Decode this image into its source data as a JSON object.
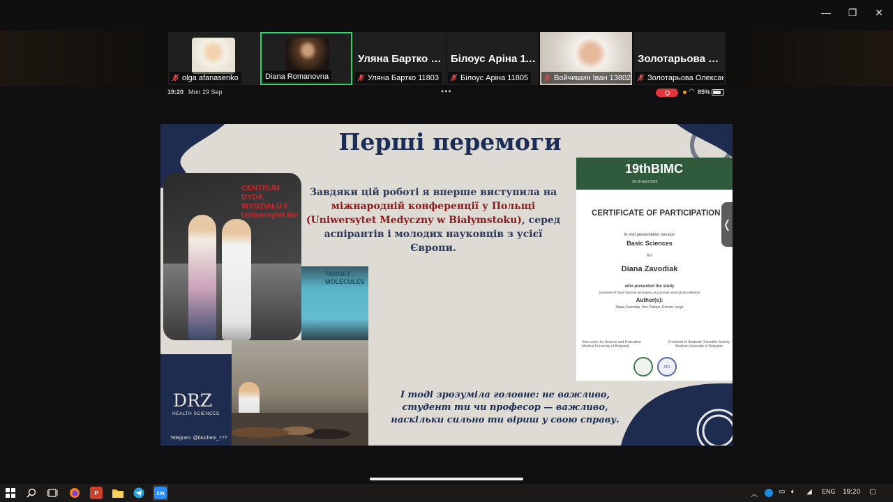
{
  "window": {
    "controls": {
      "minimize": "—",
      "maximize": "❐",
      "close": "✕"
    }
  },
  "gallery": [
    {
      "big_name": "",
      "tag": "olga afanasenko",
      "has_photo": true,
      "active": false,
      "muted": true
    },
    {
      "big_name": "",
      "tag": "Diana Romanovna",
      "has_photo": true,
      "active": true,
      "muted": false
    },
    {
      "big_name": "Уляна Бартко 1...",
      "tag": "Уляна Бартко 11803",
      "has_photo": false,
      "active": false,
      "muted": true
    },
    {
      "big_name": "Білоус Аріна 11...",
      "tag": "Білоус Аріна 11805",
      "has_photo": false,
      "active": false,
      "muted": true
    },
    {
      "big_name": "",
      "tag": "Войчишин Іван 13802...",
      "has_photo": true,
      "active": false,
      "muted": true
    },
    {
      "big_name": "Золотарьова О...",
      "tag": "Золотарьова Олексан...",
      "has_photo": false,
      "active": false,
      "muted": true
    }
  ],
  "ipad_status": {
    "time": "19:20",
    "date": "Mon 29 Sep",
    "dots": "•••",
    "battery": "85%"
  },
  "slide": {
    "title": "Перші перемоги",
    "paragraph_before": "Завдяки цій роботі я вперше виступила на ",
    "paragraph_highlight": "міжнародній конференції у Польщі (Uniwersytet Medyczny w Białymstoku)",
    "paragraph_after": ", серед аспірантів і молодих науковців з усієї Європи.",
    "quote": "І тоді зрозуміла головне: не важливо, студент ти чи професор — важливо, наскільки сильно ти віриш у свою справу.",
    "photo1_banner_lines": [
      "CENTRUM DYDA",
      "WYDZIAŁU F",
      "Uniwersytet Me"
    ],
    "photo2_screen_text": [
      "TARGET",
      "MOLECULES"
    ],
    "logo": {
      "main": "DRZ",
      "sub": "HEALTH SCIENCES",
      "telegram": "Telegram: @biochem_777"
    },
    "certificate": {
      "header": "19thBIMC",
      "dates": "25-26 April 2025",
      "title": "CERTIFICATE OF PARTICIPATION",
      "session_label": "in oral presentation session",
      "session": "Basic Sciences",
      "for": "for",
      "name": "Diana Zavodiak",
      "presented": "who presented the study",
      "study": "Synthesis of fused thiazole derivatives as potential endocytosis inhibitors",
      "authors_label": "Author(s):",
      "authors": "Diana Zavodiak, Ihor Yushyn, Roman Lesyk",
      "sig_left": "Vice-rector for Science and Evaluation\nMedical University of Bialystok",
      "sig_right": "President of Students' Scientific Society\nMedical University of Bialystok",
      "seal_right_text": "stn"
    },
    "handle": "❬"
  },
  "taskbar": {
    "lang": "ENG",
    "time": "19:20",
    "apps": [
      "start",
      "search",
      "task-view",
      "firefox",
      "powerpoint",
      "explorer",
      "telegram",
      "zoom"
    ],
    "zoom_label": "zm",
    "ppt_label": "P"
  },
  "colors": {
    "active_tile": "#23d96b",
    "slide_navy": "#1b2c56",
    "highlight_red": "#8f1c1c",
    "cert_green": "#2f5a3c",
    "record": "#e0353a"
  }
}
